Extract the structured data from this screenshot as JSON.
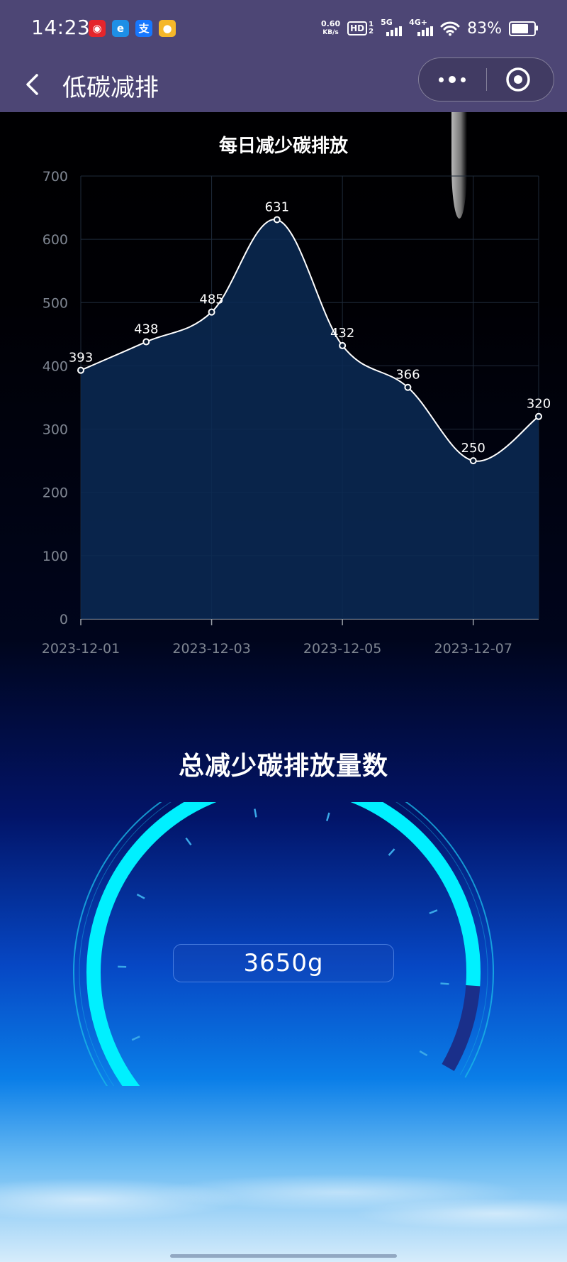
{
  "status_bar": {
    "time": "14:23",
    "app_icons": [
      {
        "name": "netease-music-icon",
        "color": "#e5252b",
        "glyph": "◉"
      },
      {
        "name": "browser-icon",
        "color": "#1e8fe6",
        "glyph": "e"
      },
      {
        "name": "alipay-icon",
        "color": "#1677ff",
        "glyph": "支"
      },
      {
        "name": "pet-app-icon",
        "color": "#f5b72a",
        "glyph": "●"
      }
    ],
    "net_speed_value": "0.60",
    "net_speed_unit": "KB/s",
    "hd": "HD",
    "sim1": "1",
    "sim2": "2",
    "signal1_label": "5G",
    "signal2_label": "4G+",
    "battery": "83%",
    "battery_level": 0.83
  },
  "nav": {
    "title": "低碳减排"
  },
  "chart_data": {
    "type": "line",
    "title": "每日减少碳排放",
    "x": [
      "2023-12-01",
      "2023-12-02",
      "2023-12-03",
      "2023-12-04",
      "2023-12-05",
      "2023-12-06",
      "2023-12-07",
      "2023-12-08"
    ],
    "x_tick_labels": [
      "2023-12-01",
      "2023-12-03",
      "2023-12-05",
      "2023-12-07"
    ],
    "values": [
      393,
      438,
      485,
      631,
      432,
      366,
      250,
      320
    ],
    "data_labels": [
      "393",
      "438",
      "485",
      "631",
      "432",
      "366",
      "250",
      "320"
    ],
    "y_ticks": [
      "0",
      "100",
      "200",
      "300",
      "400",
      "500",
      "600",
      "700"
    ],
    "ylim": [
      0,
      700
    ],
    "smooth": true,
    "area_fill": true,
    "grid": true,
    "colors": {
      "line": "#ffffff",
      "area": "#0a2a55",
      "grid": "#1e2a3a",
      "axis_text": "#7f8692"
    }
  },
  "total": {
    "title": "总减少碳排放量数",
    "value": "3650g",
    "gauge_fraction": 0.9,
    "colors": {
      "arc": "#00f0ff",
      "track": "#1a2f8a",
      "ring": "#19b6e6"
    }
  }
}
